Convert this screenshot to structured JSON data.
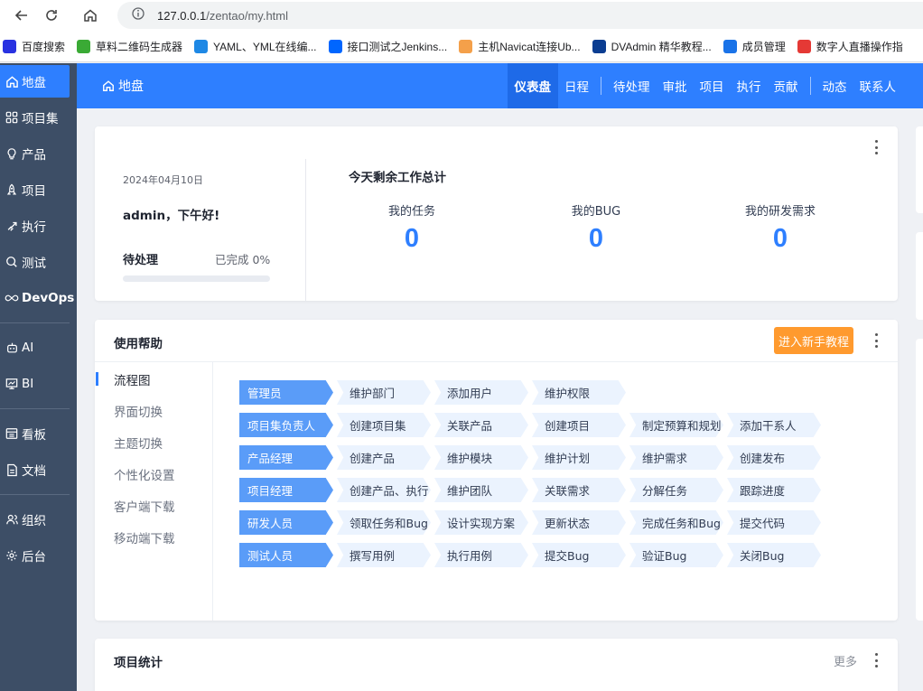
{
  "browser": {
    "url_host": "127.0.0.1",
    "url_path": "/zentao/my.html",
    "bookmarks": [
      {
        "label": "百度搜索",
        "icon": "baidu-paw-icon",
        "color": "#2932e1"
      },
      {
        "label": "草料二维码生成器",
        "icon": "qr-grid-icon",
        "color": "#3aaa35"
      },
      {
        "label": "YAML、YML在线编...",
        "icon": "bejson-icon",
        "color": "#1e88e5"
      },
      {
        "label": "接口测试之Jenkins...",
        "icon": "zhihu-icon",
        "color": "#0066ff"
      },
      {
        "label": "主机Navicat连接Ub...",
        "icon": "pin-icon",
        "color": "#f4a04a"
      },
      {
        "label": "DVAdmin 精华教程...",
        "icon": "eye-icon",
        "color": "#0b3d91"
      },
      {
        "label": "成员管理",
        "icon": "translate-icon",
        "color": "#1a73e8"
      },
      {
        "label": "数字人直播操作指",
        "icon": "check-badge-icon",
        "color": "#e53935"
      }
    ]
  },
  "sidebar": {
    "items": [
      {
        "label": "地盘",
        "icon": "home-icon",
        "active": true
      },
      {
        "label": "项目集",
        "icon": "grid-icon"
      },
      {
        "label": "产品",
        "icon": "bulb-icon"
      },
      {
        "label": "项目",
        "icon": "rocket-icon"
      },
      {
        "label": "执行",
        "icon": "run-icon"
      },
      {
        "label": "测试",
        "icon": "magnifier-icon"
      },
      {
        "label": "DevOps",
        "icon": "infinity-icon"
      },
      {
        "label": "AI",
        "icon": "robot-icon"
      },
      {
        "label": "BI",
        "icon": "chart-board-icon"
      },
      {
        "label": "看板",
        "icon": "kanban-icon"
      },
      {
        "label": "文档",
        "icon": "document-icon"
      },
      {
        "label": "组织",
        "icon": "users-icon"
      },
      {
        "label": "后台",
        "icon": "gear-icon"
      }
    ]
  },
  "header": {
    "brand": "地盘",
    "tabs": [
      "仪表盘",
      "日程",
      "待处理",
      "审批",
      "项目",
      "执行",
      "贡献",
      "动态",
      "联系人"
    ],
    "active_tab": "仪表盘"
  },
  "welcome": {
    "date": "2024年04月10日",
    "greeting": "admin，下午好!",
    "todo_label": "待处理",
    "done_label": "已完成 0%",
    "done_progress": 0,
    "work_title": "今天剩余工作总计",
    "stats": [
      {
        "label": "我的任务",
        "value": "0"
      },
      {
        "label": "我的BUG",
        "value": "0"
      },
      {
        "label": "我的研发需求",
        "value": "0"
      }
    ]
  },
  "help": {
    "title": "使用帮助",
    "guide_button": "进入新手教程",
    "menu": [
      "流程图",
      "界面切换",
      "主题切换",
      "个性化设置",
      "客户端下载",
      "移动端下载"
    ],
    "active_menu": "流程图",
    "flow": [
      {
        "role": "管理员",
        "steps": [
          "维护部门",
          "添加用户",
          "维护权限"
        ]
      },
      {
        "role": "项目集负责人",
        "steps": [
          "创建项目集",
          "关联产品",
          "创建项目",
          "制定预算和规划",
          "添加干系人"
        ]
      },
      {
        "role": "产品经理",
        "steps": [
          "创建产品",
          "维护模块",
          "维护计划",
          "维护需求",
          "创建发布"
        ]
      },
      {
        "role": "项目经理",
        "steps": [
          "创建产品、执行",
          "维护团队",
          "关联需求",
          "分解任务",
          "跟踪进度"
        ]
      },
      {
        "role": "研发人员",
        "steps": [
          "领取任务和Bug",
          "设计实现方案",
          "更新状态",
          "完成任务和Bug",
          "提交代码"
        ]
      },
      {
        "role": "测试人员",
        "steps": [
          "撰写用例",
          "执行用例",
          "提交Bug",
          "验证Bug",
          "关闭Bug"
        ]
      }
    ]
  },
  "project_stats": {
    "title": "项目统计",
    "more": "更多"
  }
}
